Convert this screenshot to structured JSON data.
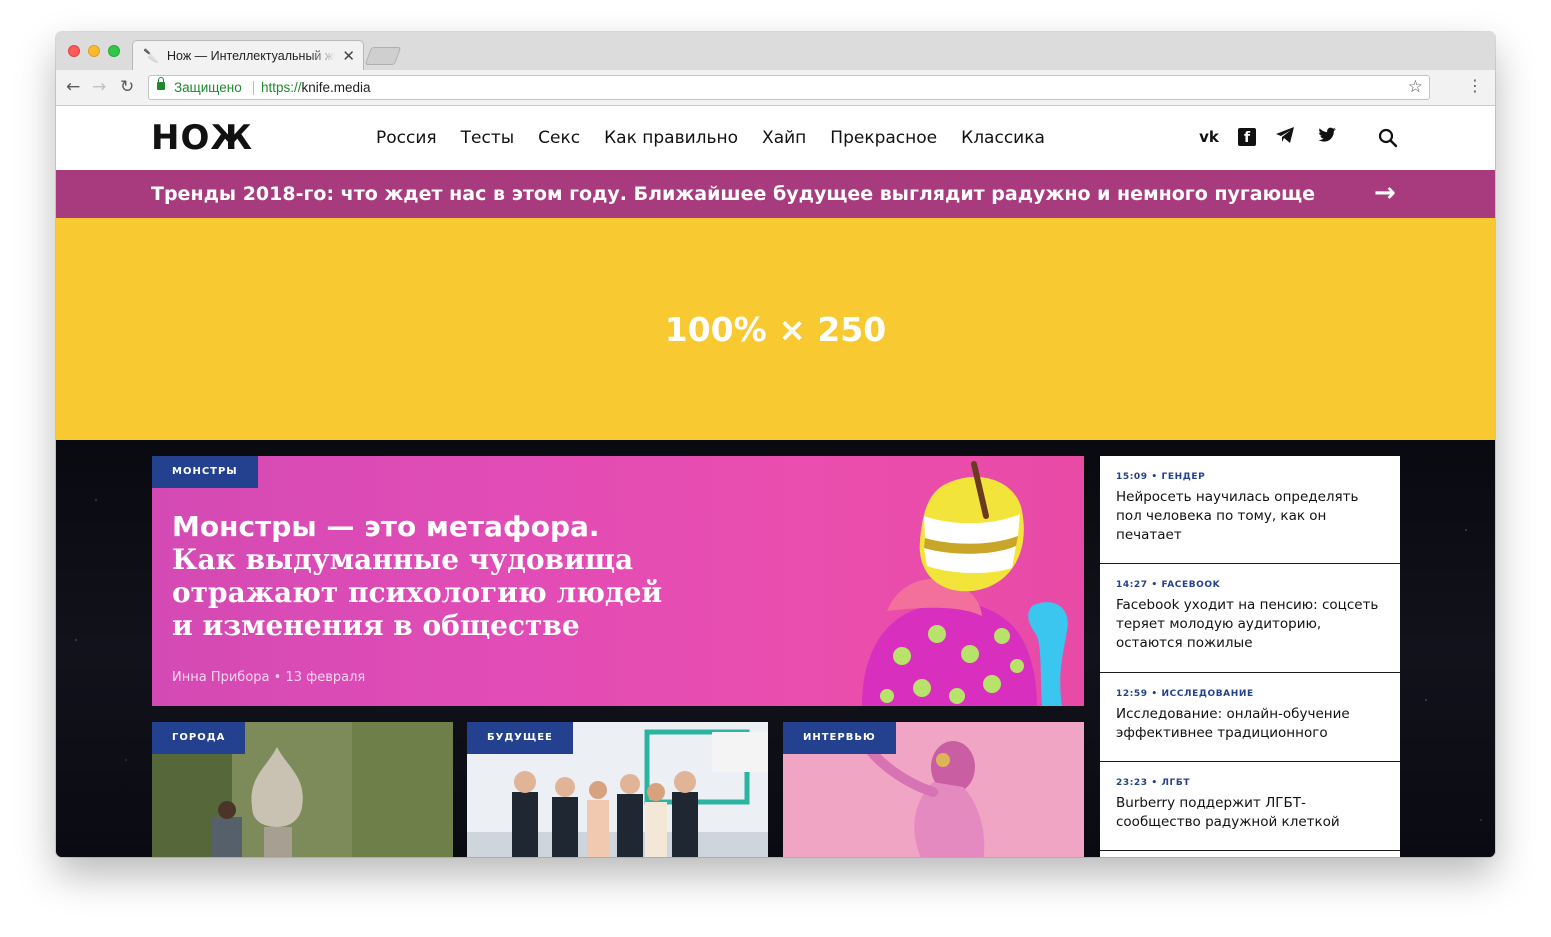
{
  "browser": {
    "tab_title": "Нож — Интеллектуальный журнал",
    "tab_close": "✕",
    "secure_label": "Защищено",
    "url_scheme": "https://",
    "url_host": "knife.media"
  },
  "header": {
    "logo": "НОЖ",
    "nav": [
      "Россия",
      "Тесты",
      "Секс",
      "Как правильно",
      "Хайп",
      "Прекрасное",
      "Классика"
    ],
    "social_icons": [
      "vk-icon",
      "facebook-icon",
      "telegram-icon",
      "twitter-icon"
    ],
    "social_glyphs": {
      "vk": "vk",
      "facebook": "f",
      "telegram": "➤",
      "twitter": "🐦"
    }
  },
  "promo": {
    "text": "Тренды 2018-го: что ждет нас в этом году. Ближайшее будущее выглядит радужно и немного пугающе",
    "arrow": "→"
  },
  "ad": {
    "text": "100% × 250",
    "color": "#f9c932"
  },
  "hero": {
    "category": "МОНСТРЫ",
    "title_bold": "Монстры — это метафора.",
    "title_rest": " Как выдуманные чудовища отражают психологию людей и изменения в обществе",
    "author": "Инна Прибора",
    "date": "13 февраля"
  },
  "cards": [
    {
      "category": "ГОРОДА"
    },
    {
      "category": "БУДУЩЕЕ"
    },
    {
      "category": "ИНТЕРВЬЮ"
    }
  ],
  "news": [
    {
      "time": "15:09",
      "tag": "ГЕНДЕР",
      "title": "Нейросеть научилась определять пол человека по тому, как он печатает"
    },
    {
      "time": "14:27",
      "tag": "FACEBOOK",
      "title": "Facebook уходит на пенсию: соцсеть теряет молодую аудиторию, остаются пожилые"
    },
    {
      "time": "12:59",
      "tag": "ИССЛЕДОВАНИЕ",
      "title": "Исследование: онлайн-обучение эффективнее традиционного"
    },
    {
      "time": "23:23",
      "tag": "ЛГБТ",
      "title": "Burberry поддержит ЛГБТ-сообщество радужной клеткой"
    }
  ],
  "colors": {
    "promo": "#a83b7d",
    "label": "#23418e",
    "hero": "#e24cb6"
  }
}
